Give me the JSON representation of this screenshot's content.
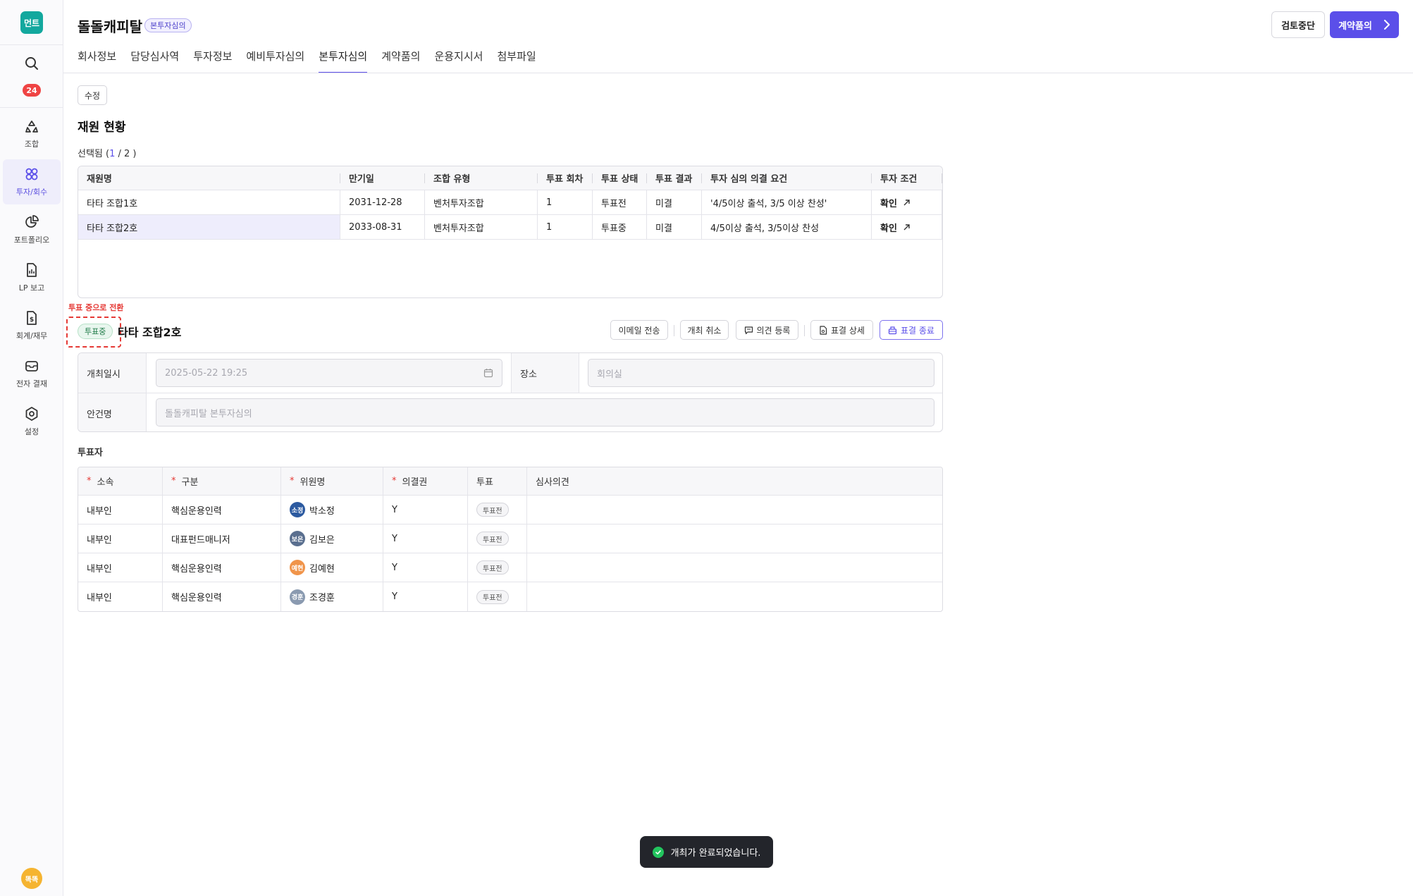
{
  "sidebar": {
    "logo": "먼트",
    "notification_count": "24",
    "items": [
      {
        "label": "조합",
        "icon": "recycle-icon"
      },
      {
        "label": "투자/회수",
        "icon": "investment-icon"
      },
      {
        "label": "포트폴리오",
        "icon": "pie-chart-icon"
      },
      {
        "label": "LP 보고",
        "icon": "report-icon"
      },
      {
        "label": "회계/재무",
        "icon": "accounting-icon"
      },
      {
        "label": "전자 결재",
        "icon": "inbox-icon"
      },
      {
        "label": "설정",
        "icon": "settings-icon"
      }
    ],
    "active_item": "투자/회수",
    "user_avatar": "똑똑"
  },
  "header": {
    "company_name": "돌돌캐피탈",
    "stage_badge": "본투자심의",
    "stop_review_label": "검토중단",
    "contract_approval_label": "계약품의",
    "tabs": [
      "회사정보",
      "담당심사역",
      "투자정보",
      "예비투자심의",
      "본투자심의",
      "계약품의",
      "운용지시서",
      "첨부파일"
    ],
    "active_tab": "본투자심의"
  },
  "main": {
    "edit_label": "수정",
    "section_title": "재원 현황",
    "selected_prefix": "선택됨 (",
    "selected_current": "1",
    "selected_suffix": "/ 2 )",
    "fund_table": {
      "headers": [
        "재원명",
        "만기일",
        "조합 유형",
        "투표 회차",
        "투표 상태",
        "투표 결과",
        "투자 심의 의결 요건",
        "투자 조건"
      ],
      "rows": [
        [
          "타타 조합1호",
          "2031-12-28",
          "벤처투자조합",
          "1",
          "투표전",
          "미결",
          "'4/5이상 출석, 3/5 이상 찬성'",
          "확인"
        ],
        [
          "타타 조합2호",
          "2033-08-31",
          "벤처투자조합",
          "1",
          "투표중",
          "미결",
          "4/5이상 출석, 3/5이상 찬성",
          "확인"
        ]
      ]
    },
    "annotation_note": "투표 중으로 전환",
    "meeting": {
      "status": "투표중",
      "fund_name": "타타 조합2호",
      "actions": {
        "send_email": "이메일 전송",
        "cancel_meeting": "개최 취소",
        "register_opinion": "의견 등록",
        "vote_detail": "표결 상세",
        "end_vote": "표결 종료"
      },
      "date_label": "개최일시",
      "date_value": "2025-05-22 19:25",
      "place_label": "장소",
      "place_placeholder": "회의실",
      "agenda_label": "안건명",
      "agenda_placeholder": "돌돌캐피탈 본투자심의"
    },
    "voters_title": "투표자",
    "voter_table": {
      "headers": [
        "소속",
        "구분",
        "위원명",
        "의결권",
        "투표",
        "심사의견"
      ],
      "rows": [
        {
          "affiliation": "내부인",
          "category": "핵심운용인력",
          "avatar": "소정",
          "avatar_color": "#2c5aa0",
          "name": "박소정",
          "voting_right": "Y",
          "vote": "투표전",
          "opinion": ""
        },
        {
          "affiliation": "내부인",
          "category": "대표펀드매니저",
          "avatar": "보은",
          "avatar_color": "#5a6f8f",
          "name": "김보은",
          "voting_right": "Y",
          "vote": "투표전",
          "opinion": ""
        },
        {
          "affiliation": "내부인",
          "category": "핵심운용인력",
          "avatar": "예현",
          "avatar_color": "#f0944a",
          "name": "김예현",
          "voting_right": "Y",
          "vote": "투표전",
          "opinion": ""
        },
        {
          "affiliation": "내부인",
          "category": "핵심운용인력",
          "avatar": "경훈",
          "avatar_color": "#8a9ab0",
          "name": "조경훈",
          "voting_right": "Y",
          "vote": "투표전",
          "opinion": ""
        }
      ]
    }
  },
  "toast": {
    "message": "개최가 완료되었습니다."
  },
  "colors": {
    "accent": "#5b4fe9",
    "logo": "#13a89e",
    "badge": "#ef4444",
    "annotation": "#e53935"
  }
}
